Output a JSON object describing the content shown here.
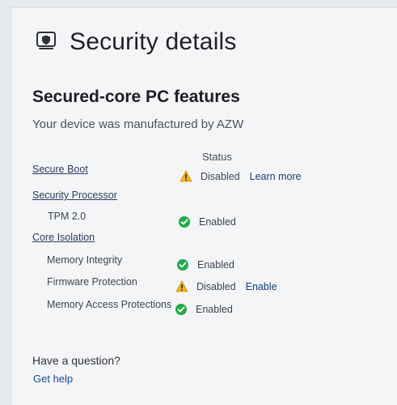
{
  "page": {
    "title": "Security details",
    "section_title": "Secured-core PC features",
    "subtitle": "Your device was manufactured by AZW",
    "status_header": "Status"
  },
  "features": {
    "secure_boot": {
      "label": "Secure Boot",
      "status": "Disabled",
      "action": "Learn more",
      "icon": "warning-icon"
    },
    "security_processor": {
      "label": "Security Processor"
    },
    "tpm": {
      "label": "TPM 2.0",
      "status": "Enabled",
      "icon": "check-icon"
    },
    "core_isolation": {
      "label": "Core Isolation"
    },
    "memory_integrity": {
      "label": "Memory Integrity",
      "status": "Enabled",
      "icon": "check-icon"
    },
    "firmware_protection": {
      "label": "Firmware Protection",
      "status": "Disabled",
      "action": "Enable",
      "icon": "warning-icon"
    },
    "memory_access_protections": {
      "label": "Memory Access Protections",
      "status": "Enabled",
      "icon": "check-icon"
    }
  },
  "help": {
    "question": "Have a question?",
    "link": "Get help"
  },
  "colors": {
    "success": "#25a84b",
    "warning": "#f2b51b",
    "link": "#174a8f"
  }
}
